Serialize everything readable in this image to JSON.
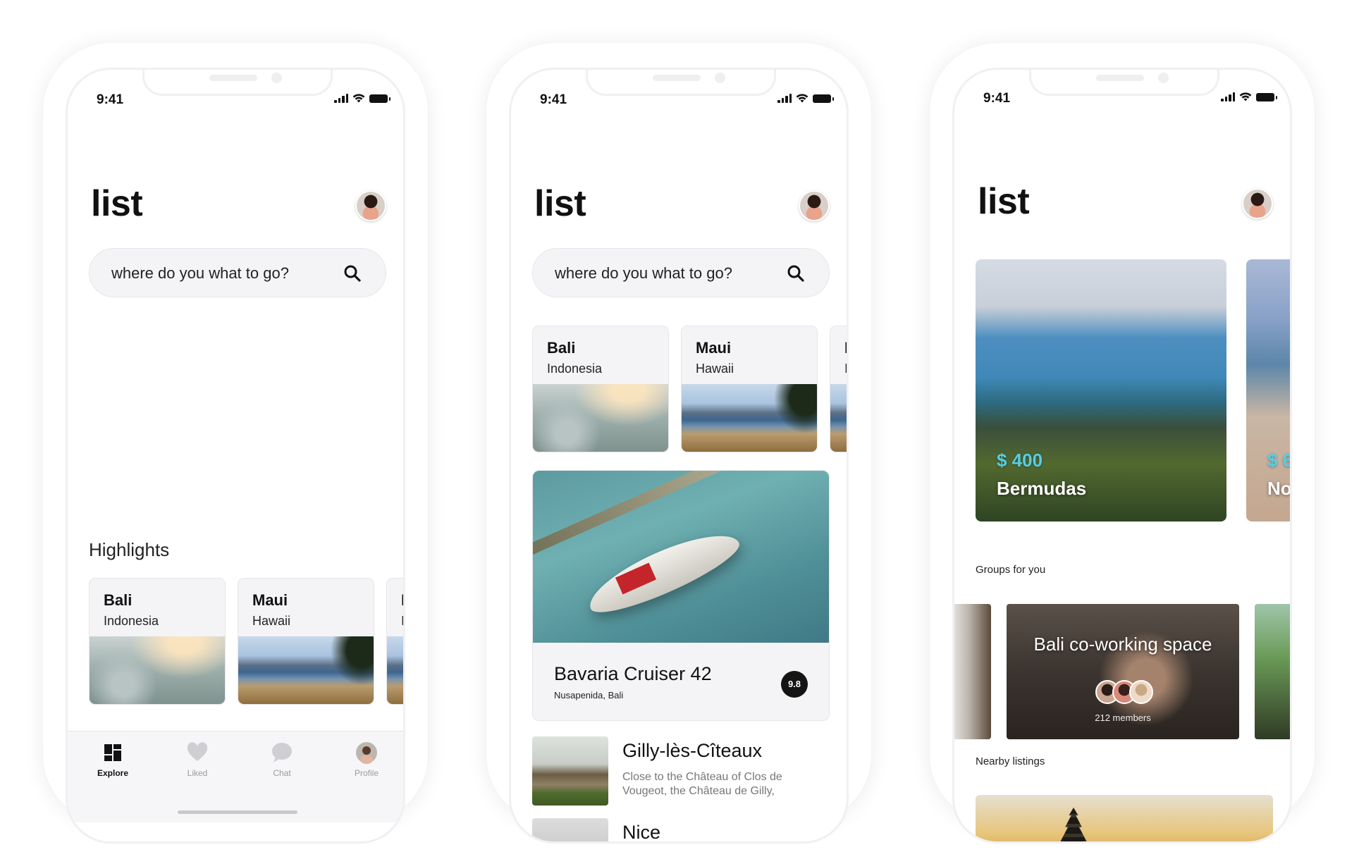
{
  "status": {
    "time": "9:41"
  },
  "phone1": {
    "title": "list",
    "search_placeholder": "where do you what to go?",
    "highlights_label": "Highlights",
    "destinations": [
      {
        "name": "Bali",
        "country": "Indonesia"
      },
      {
        "name": "Maui",
        "country": "Hawaii"
      },
      {
        "name": "I",
        "country": "I"
      }
    ],
    "tabs": [
      {
        "label": "Explore",
        "icon": "grid-icon",
        "active": true
      },
      {
        "label": "Liked",
        "icon": "heart-icon",
        "active": false
      },
      {
        "label": "Chat",
        "icon": "chat-bubble-icon",
        "active": false
      },
      {
        "label": "Profile",
        "icon": "profile-avatar-icon",
        "active": false
      }
    ]
  },
  "phone2": {
    "title": "list",
    "search_placeholder": "where do you what to go?",
    "destinations": [
      {
        "name": "Bali",
        "country": "Indonesia"
      },
      {
        "name": "Maui",
        "country": "Hawaii"
      },
      {
        "name": "I",
        "country": "I"
      }
    ],
    "featured": {
      "name": "Bavaria Cruiser 42",
      "location": "Nusapenida, Bali",
      "rating": "9.8"
    },
    "listings": [
      {
        "title": "Gilly-lès-Cîteaux",
        "description": "Close to the Château of Clos de Vougeot, the Château de Gilly,"
      },
      {
        "title": "Nice",
        "description": ""
      }
    ]
  },
  "phone3": {
    "title": "list",
    "cards": [
      {
        "price": "$ 400",
        "place": "Bermudas"
      },
      {
        "price": "$ 6",
        "place": "No"
      }
    ],
    "groups_label": "Groups for you",
    "groups": [
      {
        "name": "Bali co-working space",
        "members": "212 members"
      }
    ],
    "nearby_label": "Nearby listings"
  },
  "colors": {
    "accent": "#56cde6",
    "rating_bg": "#141414",
    "card_bg": "#f4f4f6"
  }
}
